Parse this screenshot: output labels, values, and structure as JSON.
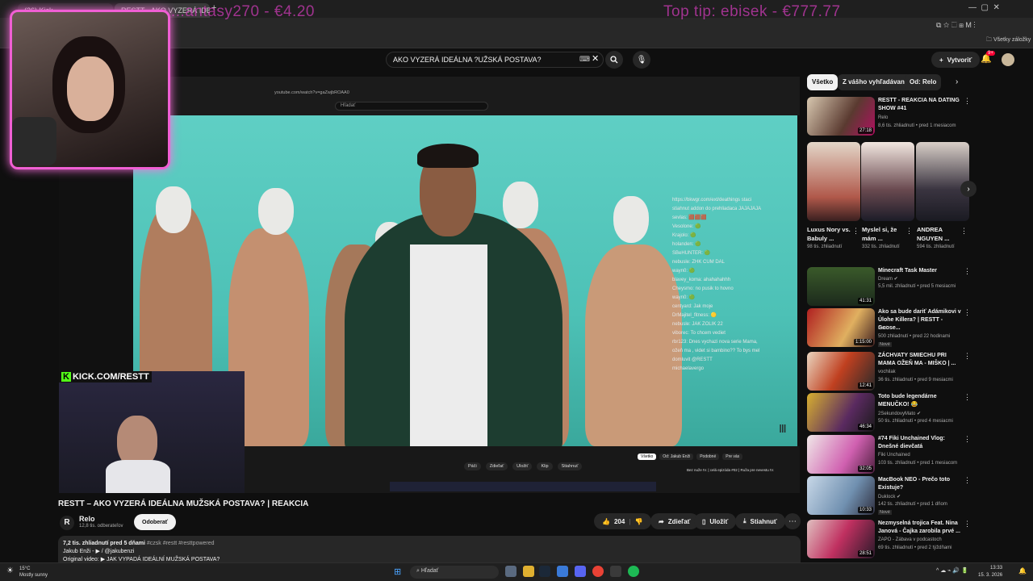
{
  "browser": {
    "tabs": [
      "(26) Kick ...",
      "RESTT - AKO VYZERÁ IDE...",
      "Kick Cheeky..."
    ],
    "bookmarks_label": "Všetky záložky"
  },
  "overlay": {
    "donation_left": "...antasy270 - €4.20",
    "donation_right": "Top tip: ebisek - €777.77"
  },
  "youtube": {
    "search_value": "AKO VYZERÁ IDEÁLNA ?UŽSKÁ POSTAVA?",
    "create_label": "Vytvoriť",
    "notif_count": "9+",
    "video": {
      "title": "RESTT – AKO VYZERÁ IDEÁLNA MUŽSKÁ POSTAVA? | REAKCIA",
      "channel": "Relo",
      "subscribers": "12,8 tis. odberateľov",
      "subscribe_label": "Odoberať",
      "likes": "204",
      "share_label": "Zdieľať",
      "save_label": "Uložiť",
      "download_label": "Stiahnuť",
      "views_line": "7,2 tis. zhliadnutí  pred 5 dňami",
      "tags": "#czsk #restt #resttpowered",
      "desc_line1": "Jakub Enži - ▶ / @jakubenzi",
      "desc_line2": "Original video: ▶ JAK VYPADÁ IDEÁLNÍ MUŽSKÁ POSTAVA?"
    },
    "stream": {
      "kick_label": "KICK.COM/RESTT",
      "inner_search": "Hľadať",
      "inner_url": "youtube.com/watch?v=gaZwjbROAA0",
      "inner_actions": [
        "Páči",
        "Zdieľať",
        "Uložiť",
        "Klip",
        "Stiahnuť"
      ],
      "inner_chips": [
        "Všetko",
        "Od: Jakub Enži",
        "Podobné",
        "Pre vás"
      ],
      "inner_rec": "Bez nuže IV. | celá epizóda #02 | Ruža pre nevestu IV.",
      "chat": [
        "https://bkwgr.com/ext/deathings staci",
        "stiahnut addon do prehliadaca JAJAJAJA",
        "sevlas: 🟫🟫🟫",
        "Vesolone: 🟢",
        "Krajolo: 🟢",
        "holanden: 🟢",
        "SBeHUNTER: 🟢",
        "nebusle: ZHK CUM DAL",
        "wayn0: 🟢",
        "blavey_koma: ahahahahhh",
        "Cheysmo: no pusik to hovno",
        "wayn0: 🟢",
        "centyard: Jak moje",
        "DrMajitel_fitness: 🟡",
        "nebusle: JAK ZOLIK 22",
        "viborec: To chcem vediet",
        "rbr123: Dnes vychazi nova serie Mama,",
        "ožeň ma , videt si bambino?? To bys mel",
        "domluvit @RESTT",
        "michaelavergo"
      ]
    },
    "chips": [
      "Všetko",
      "Z vášho vyhľadávania",
      "Od: Relo"
    ],
    "recommendations_top": {
      "title": "RESTT - REAKCIA NA DATING SHOW #41",
      "channel": "Relo",
      "meta": "8,6 tis. zhliadnutí • pred 1 mesiacom",
      "duration": "27:18"
    },
    "shorts": [
      {
        "title": "Luxus Nory vs. Babuly ...",
        "meta": "98 tis. zhliadnutí"
      },
      {
        "title": "Myslel si, že mám ...",
        "meta": "332 tis. zhliadnutí"
      },
      {
        "title": "ANDREA NGUYEN ...",
        "meta": "594 tis. zhliadnutí"
      }
    ],
    "recommendations": [
      {
        "title": "Minecraft Task Master",
        "channel": "Dream ✔",
        "meta": "5,5 mil. zhliadnutí • pred 5 mesiacmi",
        "duration": "41:31",
        "badge": ""
      },
      {
        "title": "Ako sa bude dariť Adámikovi v Úlohe Killera? | RESTT - Goose...",
        "channel": "blud",
        "meta": "500 zhliadnutí • pred 22 hodinami",
        "duration": "1:15:00",
        "badge": "Nové"
      },
      {
        "title": "ZÁCHVATY SMIECHU PRI MAMA OŽEŇ MA - MIŠKO | ...",
        "channel": "vochilak",
        "meta": "36 tis. zhliadnutí • pred 9 mesiacmi",
        "duration": "12:41",
        "badge": ""
      },
      {
        "title": "Toto bude legendárne MENUČKO! 😂",
        "channel": "2SekundovyMato ✔",
        "meta": "50 tis. zhliadnutí • pred 4 mesiacmi",
        "duration": "46:34",
        "badge": ""
      },
      {
        "title": "#74 Fiki Unchained Vlog: Dnešné dievčatá",
        "channel": "Fiki Unchained",
        "meta": "103 tis. zhliadnutí • pred 1 mesiacom",
        "duration": "32:05",
        "badge": ""
      },
      {
        "title": "MacBook NEO - Prečo toto Existuje?",
        "channel": "Duklock ✔",
        "meta": "142 tis. zhliadnutí • pred 1 dňom",
        "duration": "10:33",
        "badge": "Nové"
      },
      {
        "title": "Nezmyselná trojica Feat. Nina Janová - Čajka zarobila prvé ...",
        "channel": "ZAPO - Zábava v podcastoch",
        "meta": "69 tis. zhliadnutí • pred 2 týždňami",
        "duration": "28:51",
        "badge": ""
      }
    ]
  },
  "taskbar": {
    "weather_temp": "15°C",
    "weather_desc": "Mostly sunny",
    "search_placeholder": "Hľadať",
    "time": "13:33",
    "date": "15. 3. 2026"
  },
  "colors": {
    "accent_red": "#ff0033",
    "overlay_pink": "#d63cbe",
    "cam_border": "#f05fd4",
    "backdrop_teal": "#4dc1b6"
  }
}
